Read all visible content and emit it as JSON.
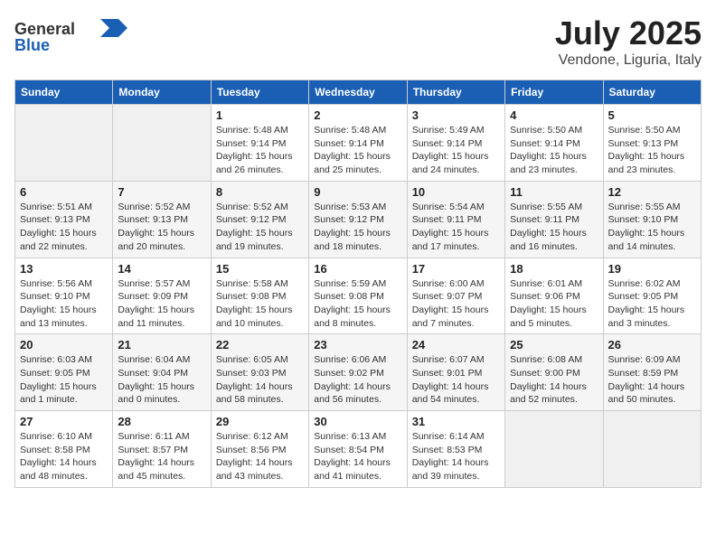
{
  "header": {
    "logo": {
      "general": "General",
      "blue": "Blue"
    },
    "title": "July 2025",
    "location": "Vendone, Liguria, Italy"
  },
  "calendar": {
    "days_of_week": [
      "Sunday",
      "Monday",
      "Tuesday",
      "Wednesday",
      "Thursday",
      "Friday",
      "Saturday"
    ],
    "weeks": [
      [
        {
          "day": "",
          "info": ""
        },
        {
          "day": "",
          "info": ""
        },
        {
          "day": "1",
          "info": "Sunrise: 5:48 AM\nSunset: 9:14 PM\nDaylight: 15 hours\nand 26 minutes."
        },
        {
          "day": "2",
          "info": "Sunrise: 5:48 AM\nSunset: 9:14 PM\nDaylight: 15 hours\nand 25 minutes."
        },
        {
          "day": "3",
          "info": "Sunrise: 5:49 AM\nSunset: 9:14 PM\nDaylight: 15 hours\nand 24 minutes."
        },
        {
          "day": "4",
          "info": "Sunrise: 5:50 AM\nSunset: 9:14 PM\nDaylight: 15 hours\nand 23 minutes."
        },
        {
          "day": "5",
          "info": "Sunrise: 5:50 AM\nSunset: 9:13 PM\nDaylight: 15 hours\nand 23 minutes."
        }
      ],
      [
        {
          "day": "6",
          "info": "Sunrise: 5:51 AM\nSunset: 9:13 PM\nDaylight: 15 hours\nand 22 minutes."
        },
        {
          "day": "7",
          "info": "Sunrise: 5:52 AM\nSunset: 9:13 PM\nDaylight: 15 hours\nand 20 minutes."
        },
        {
          "day": "8",
          "info": "Sunrise: 5:52 AM\nSunset: 9:12 PM\nDaylight: 15 hours\nand 19 minutes."
        },
        {
          "day": "9",
          "info": "Sunrise: 5:53 AM\nSunset: 9:12 PM\nDaylight: 15 hours\nand 18 minutes."
        },
        {
          "day": "10",
          "info": "Sunrise: 5:54 AM\nSunset: 9:11 PM\nDaylight: 15 hours\nand 17 minutes."
        },
        {
          "day": "11",
          "info": "Sunrise: 5:55 AM\nSunset: 9:11 PM\nDaylight: 15 hours\nand 16 minutes."
        },
        {
          "day": "12",
          "info": "Sunrise: 5:55 AM\nSunset: 9:10 PM\nDaylight: 15 hours\nand 14 minutes."
        }
      ],
      [
        {
          "day": "13",
          "info": "Sunrise: 5:56 AM\nSunset: 9:10 PM\nDaylight: 15 hours\nand 13 minutes."
        },
        {
          "day": "14",
          "info": "Sunrise: 5:57 AM\nSunset: 9:09 PM\nDaylight: 15 hours\nand 11 minutes."
        },
        {
          "day": "15",
          "info": "Sunrise: 5:58 AM\nSunset: 9:08 PM\nDaylight: 15 hours\nand 10 minutes."
        },
        {
          "day": "16",
          "info": "Sunrise: 5:59 AM\nSunset: 9:08 PM\nDaylight: 15 hours\nand 8 minutes."
        },
        {
          "day": "17",
          "info": "Sunrise: 6:00 AM\nSunset: 9:07 PM\nDaylight: 15 hours\nand 7 minutes."
        },
        {
          "day": "18",
          "info": "Sunrise: 6:01 AM\nSunset: 9:06 PM\nDaylight: 15 hours\nand 5 minutes."
        },
        {
          "day": "19",
          "info": "Sunrise: 6:02 AM\nSunset: 9:05 PM\nDaylight: 15 hours\nand 3 minutes."
        }
      ],
      [
        {
          "day": "20",
          "info": "Sunrise: 6:03 AM\nSunset: 9:05 PM\nDaylight: 15 hours\nand 1 minute."
        },
        {
          "day": "21",
          "info": "Sunrise: 6:04 AM\nSunset: 9:04 PM\nDaylight: 15 hours\nand 0 minutes."
        },
        {
          "day": "22",
          "info": "Sunrise: 6:05 AM\nSunset: 9:03 PM\nDaylight: 14 hours\nand 58 minutes."
        },
        {
          "day": "23",
          "info": "Sunrise: 6:06 AM\nSunset: 9:02 PM\nDaylight: 14 hours\nand 56 minutes."
        },
        {
          "day": "24",
          "info": "Sunrise: 6:07 AM\nSunset: 9:01 PM\nDaylight: 14 hours\nand 54 minutes."
        },
        {
          "day": "25",
          "info": "Sunrise: 6:08 AM\nSunset: 9:00 PM\nDaylight: 14 hours\nand 52 minutes."
        },
        {
          "day": "26",
          "info": "Sunrise: 6:09 AM\nSunset: 8:59 PM\nDaylight: 14 hours\nand 50 minutes."
        }
      ],
      [
        {
          "day": "27",
          "info": "Sunrise: 6:10 AM\nSunset: 8:58 PM\nDaylight: 14 hours\nand 48 minutes."
        },
        {
          "day": "28",
          "info": "Sunrise: 6:11 AM\nSunset: 8:57 PM\nDaylight: 14 hours\nand 45 minutes."
        },
        {
          "day": "29",
          "info": "Sunrise: 6:12 AM\nSunset: 8:56 PM\nDaylight: 14 hours\nand 43 minutes."
        },
        {
          "day": "30",
          "info": "Sunrise: 6:13 AM\nSunset: 8:54 PM\nDaylight: 14 hours\nand 41 minutes."
        },
        {
          "day": "31",
          "info": "Sunrise: 6:14 AM\nSunset: 8:53 PM\nDaylight: 14 hours\nand 39 minutes."
        },
        {
          "day": "",
          "info": ""
        },
        {
          "day": "",
          "info": ""
        }
      ]
    ]
  }
}
